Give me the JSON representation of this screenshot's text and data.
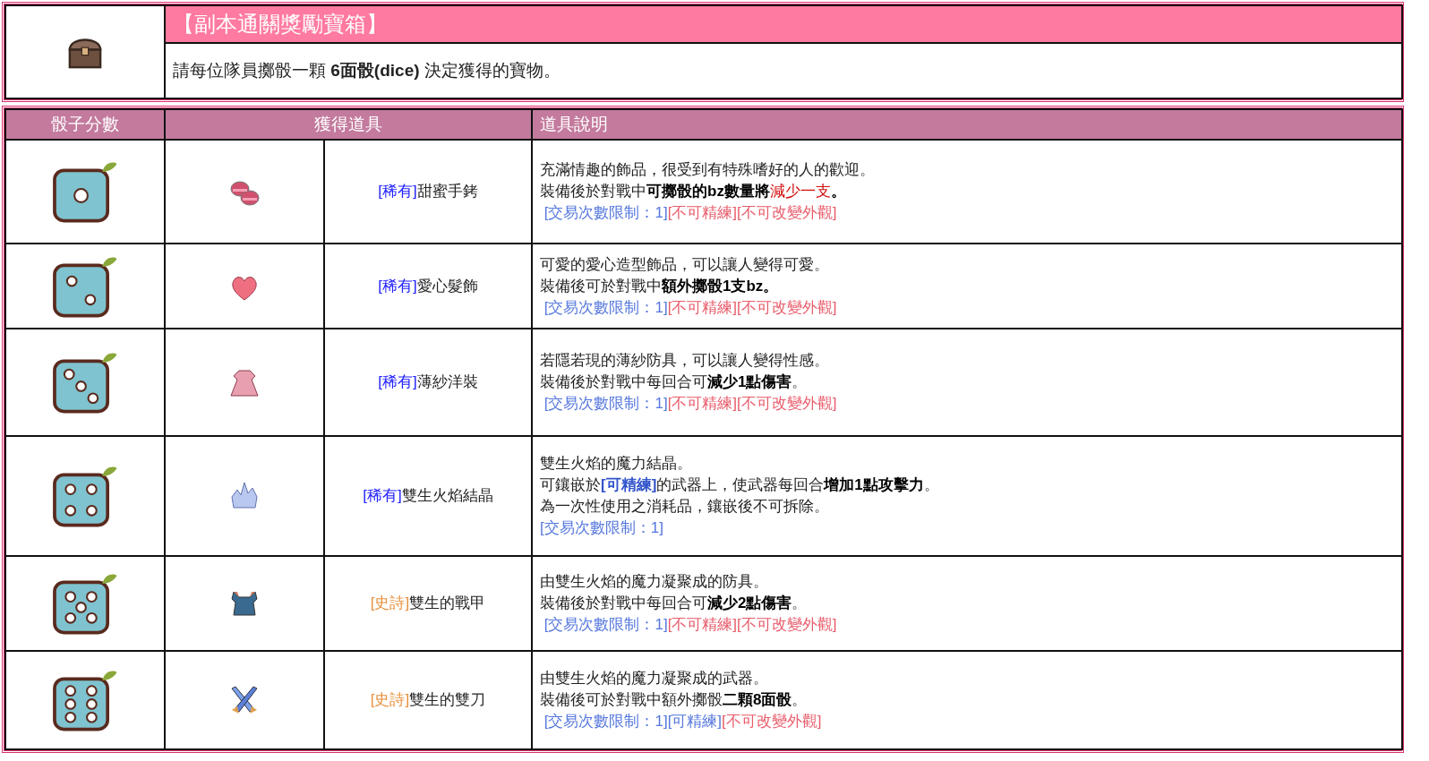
{
  "reward_box": {
    "title": "【副本通關獎勵寶箱】",
    "instruction": "請每位隊員擲骰一顆 **6面骰(dice)** 決定獲得的寶物。"
  },
  "table": {
    "columns": [
      "骰子分數",
      "獲得道具",
      "道具說明"
    ],
    "rows": [
      {
        "dice": {
          "kind": "one"
        },
        "item_icon": {
          "kind": "cuffs"
        },
        "rarity_tag": {
          "kind": "rare",
          "text": "[稀有]"
        },
        "item_name": "甜蜜手銬",
        "lines": [
          [
            {
              "text": "充滿情趣的飾品，很受到有特殊嗜好的人的歡迎。",
              "kind": "plain"
            }
          ],
          [
            {
              "text": "裝備後於對戰中",
              "kind": "plain"
            },
            {
              "text": "可擲骰的bz數量將",
              "kind": "bold"
            },
            {
              "text": "減少一支",
              "kind": "red"
            },
            {
              "text": "。",
              "kind": "bold"
            }
          ],
          [
            {
              "text": " [交易次數限制：1]",
              "kind": "blue"
            },
            {
              "text": "[不可精練]",
              "kind": "pink"
            },
            {
              "text": "[不可改變外觀]",
              "kind": "pink"
            }
          ]
        ]
      },
      {
        "dice": {
          "kind": "two"
        },
        "item_icon": {
          "kind": "heart"
        },
        "rarity_tag": {
          "kind": "rare",
          "text": "[稀有]"
        },
        "item_name": "愛心髮飾",
        "lines": [
          [
            {
              "text": "可愛的愛心造型飾品，可以讓人變得可愛。",
              "kind": "plain"
            }
          ],
          [
            {
              "text": "裝備後可於對戰中",
              "kind": "plain"
            },
            {
              "text": "額外擲骰1支bz。",
              "kind": "bold"
            }
          ],
          [
            {
              "text": " [交易次數限制：1]",
              "kind": "blue"
            },
            {
              "text": "[不可精練]",
              "kind": "pink"
            },
            {
              "text": "[不可改變外觀]",
              "kind": "pink"
            }
          ]
        ]
      },
      {
        "dice": {
          "kind": "three"
        },
        "item_icon": {
          "kind": "dress"
        },
        "rarity_tag": {
          "kind": "rare",
          "text": "[稀有]"
        },
        "item_name": "薄紗洋裝",
        "lines": [
          [
            {
              "text": "若隱若現的薄紗防具，可以讓人變得性感。",
              "kind": "plain"
            }
          ],
          [
            {
              "text": "裝備後於對戰中每回合可",
              "kind": "plain"
            },
            {
              "text": "減少1點傷害",
              "kind": "bold"
            },
            {
              "text": "。",
              "kind": "plain"
            }
          ],
          [
            {
              "text": " [交易次數限制：1]",
              "kind": "blue"
            },
            {
              "text": "[不可精練]",
              "kind": "pink"
            },
            {
              "text": "[不可改變外觀]",
              "kind": "pink"
            }
          ]
        ]
      },
      {
        "dice": {
          "kind": "four"
        },
        "item_icon": {
          "kind": "crystal"
        },
        "rarity_tag": {
          "kind": "rare",
          "text": "[稀有]"
        },
        "item_name": "雙生火焰結晶",
        "lines": [
          [
            {
              "text": "雙生火焰的魔力結晶。",
              "kind": "plain"
            }
          ],
          [
            {
              "text": "可鑲嵌於",
              "kind": "plain"
            },
            {
              "text": "[可精練]",
              "kind": "bluebold"
            },
            {
              "text": "的武器上，使武器每回合",
              "kind": "plain"
            },
            {
              "text": "增加1點攻擊力",
              "kind": "bold"
            },
            {
              "text": "。",
              "kind": "plain"
            }
          ],
          [
            {
              "text": "為一次性使用之消耗品，鑲嵌後不可拆除。",
              "kind": "plain"
            }
          ],
          [
            {
              "text": "[交易次數限制：1]",
              "kind": "blue"
            }
          ]
        ]
      },
      {
        "dice": {
          "kind": "five"
        },
        "item_icon": {
          "kind": "armor"
        },
        "rarity_tag": {
          "kind": "epic",
          "text": "[史詩]"
        },
        "item_name": "雙生的戰甲",
        "lines": [
          [
            {
              "text": "由雙生火焰的魔力凝聚成的防具。",
              "kind": "plain"
            }
          ],
          [
            {
              "text": "裝備後於對戰中每回合可",
              "kind": "plain"
            },
            {
              "text": "減少2點傷害",
              "kind": "bold"
            },
            {
              "text": "。",
              "kind": "plain"
            }
          ],
          [
            {
              "text": " [交易次數限制：1]",
              "kind": "blue"
            },
            {
              "text": "[不可精練]",
              "kind": "pink"
            },
            {
              "text": "[不可改變外觀]",
              "kind": "pink"
            }
          ]
        ]
      },
      {
        "dice": {
          "kind": "six"
        },
        "item_icon": {
          "kind": "swords"
        },
        "rarity_tag": {
          "kind": "epic",
          "text": "[史詩]"
        },
        "item_name": "雙生的雙刀",
        "lines": [
          [
            {
              "text": "由雙生火焰的魔力凝聚成的武器。",
              "kind": "plain"
            }
          ],
          [
            {
              "text": "裝備後可於對戰中額外擲骰",
              "kind": "plain"
            },
            {
              "text": "二顆8面骰",
              "kind": "bold"
            },
            {
              "text": "。",
              "kind": "plain"
            }
          ],
          [
            {
              "text": " [交易次數限制：1]",
              "kind": "blue"
            },
            {
              "text": "[可精練]",
              "kind": "blue"
            },
            {
              "text": "[不可改變外觀]",
              "kind": "pink"
            }
          ]
        ]
      }
    ]
  }
}
